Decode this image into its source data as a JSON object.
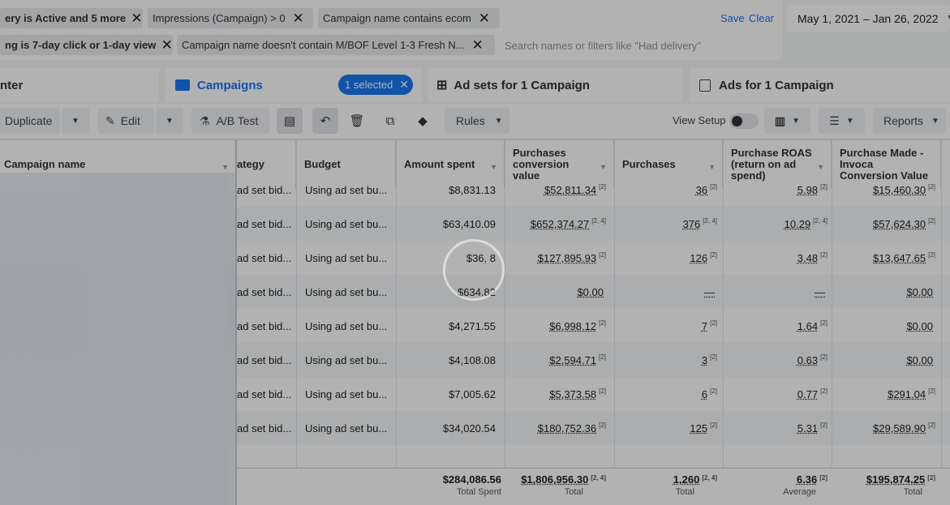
{
  "filters": {
    "row1": [
      {
        "text": "ery is Active and 5 more"
      },
      {
        "text": "Impressions (Campaign) > 0"
      },
      {
        "text": "Campaign name contains ecom"
      }
    ],
    "row2": [
      {
        "text": "ng is 7-day click or 1-day view"
      },
      {
        "text": "Campaign name doesn't contain M/BOF Level 1-3 Fresh N..."
      }
    ],
    "search_placeholder": "Search names or filters like \"Had delivery\"",
    "save_label": "Save",
    "clear_label": "Clear",
    "date_range": "May 1, 2021 – Jan 26, 2022"
  },
  "tabs": {
    "account_overview": "nter",
    "campaigns": "Campaigns",
    "selected_badge": "1 selected",
    "ad_sets": "Ad sets for 1 Campaign",
    "ads": "Ads for 1 Campaign"
  },
  "toolbar": {
    "duplicate": "Duplicate",
    "edit": "Edit",
    "ab_test": "A/B Test",
    "rules": "Rules",
    "view_setup": "View Setup",
    "reports": "Reports"
  },
  "columns": {
    "campaign_name": "Campaign name",
    "bid_strategy": "ategy",
    "budget": "Budget",
    "amount_spent": "Amount spent",
    "purchases_value": "Purchases conversion value",
    "purchases": "Purchases",
    "roas": "Purchase ROAS (return on ad spend)",
    "invoca": "Purchase Made - Invoca Conversion Value"
  },
  "rows": [
    {
      "bid": "ad set bid...",
      "budget": "Using ad set bu...",
      "spent": "$8,831.13",
      "value": "$52,811.34",
      "value_sup": "[2]",
      "purchases": "36",
      "purchases_sup": "[2]",
      "roas": "5.98",
      "roas_sup": "[2]",
      "invoca": "$15,460.30",
      "invoca_sup": "[2]"
    },
    {
      "bid": "ad set bid...",
      "budget": "Using ad set bu...",
      "spent": "$63,410.09",
      "value": "$652,374.27",
      "value_sup": "[2, 4]",
      "purchases": "376",
      "purchases_sup": "[2, 4]",
      "roas": "10.29",
      "roas_sup": "[2, 4]",
      "invoca": "$57,624.30",
      "invoca_sup": "[2]"
    },
    {
      "bid": "ad set bid...",
      "budget": "Using ad set bu...",
      "spent": "$36,   8",
      "value": "$127,895.93",
      "value_sup": "[2]",
      "purchases": "126",
      "purchases_sup": "[2]",
      "roas": "3.48",
      "roas_sup": "[2]",
      "invoca": "$13,647.65",
      "invoca_sup": "[2]"
    },
    {
      "bid": "ad set bid...",
      "budget": "Using ad set bu...",
      "spent": "$634.82",
      "value": "$0.00",
      "value_sup": "",
      "purchases": "—",
      "purchases_sup": "",
      "roas": "—",
      "roas_sup": "",
      "invoca": "$0.00",
      "invoca_sup": ""
    },
    {
      "bid": "ad set bid...",
      "budget": "Using ad set bu...",
      "spent": "$4,271.55",
      "value": "$6,998.12",
      "value_sup": "[2]",
      "purchases": "7",
      "purchases_sup": "[2]",
      "roas": "1.64",
      "roas_sup": "[2]",
      "invoca": "$0.00",
      "invoca_sup": ""
    },
    {
      "bid": "ad set bid...",
      "budget": "Using ad set bu...",
      "spent": "$4,108.08",
      "value": "$2,594.71",
      "value_sup": "[2]",
      "purchases": "3",
      "purchases_sup": "[2]",
      "roas": "0.63",
      "roas_sup": "[2]",
      "invoca": "$0.00",
      "invoca_sup": ""
    },
    {
      "bid": "ad set bid...",
      "budget": "Using ad set bu...",
      "spent": "$7,005.62",
      "value": "$5,373.58",
      "value_sup": "[2]",
      "purchases": "6",
      "purchases_sup": "[2]",
      "roas": "0.77",
      "roas_sup": "[2]",
      "invoca": "$291.04",
      "invoca_sup": "[2]"
    },
    {
      "bid": "ad set bid...",
      "budget": "Using ad set bu...",
      "spent": "$34,020.54",
      "value": "$180,752.36",
      "value_sup": "[2]",
      "purchases": "125",
      "purchases_sup": "[2]",
      "roas": "5.31",
      "roas_sup": "[2]",
      "invoca": "$29,589.90",
      "invoca_sup": "[2]"
    }
  ],
  "totals": {
    "spent": "$284,086.56",
    "spent_label": "Total Spent",
    "value": "$1,806,956.30",
    "value_sup": "[2, 4]",
    "value_label": "Total",
    "purchases": "1,260",
    "purchases_sup": "[2, 4]",
    "purchases_label": "Total",
    "roas": "6.36",
    "roas_sup": "[2]",
    "roas_label": "Average",
    "invoca": "$195,874.25",
    "invoca_sup": "[2]",
    "invoca_label": "Total"
  }
}
